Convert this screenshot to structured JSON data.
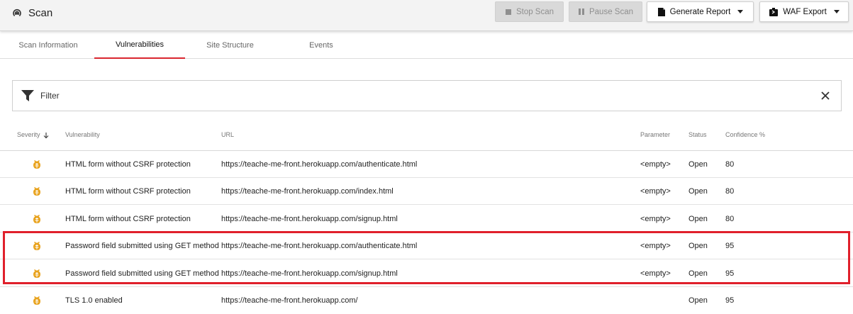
{
  "header": {
    "title": "Scan",
    "buttons": {
      "stop_scan": "Stop Scan",
      "pause_scan": "Pause Scan",
      "generate_report": "Generate Report",
      "waf_export": "WAF Export"
    }
  },
  "tabs": [
    {
      "label": "Scan Information",
      "active": false
    },
    {
      "label": "Vulnerabilities",
      "active": true
    },
    {
      "label": "Site Structure",
      "active": false
    },
    {
      "label": "Events",
      "active": false
    }
  ],
  "filter": {
    "placeholder": "Filter"
  },
  "table": {
    "columns": {
      "severity": "Severity",
      "vulnerability": "Vulnerability",
      "url": "URL",
      "parameter": "Parameter",
      "status": "Status",
      "confidence": "Confidence %"
    },
    "sort_indicator": "descending",
    "rows": [
      {
        "vulnerability": "HTML form without CSRF protection",
        "url": "https://teache-me-front.herokuapp.com/authenticate.html",
        "parameter": "<empty>",
        "status": "Open",
        "confidence": "80"
      },
      {
        "vulnerability": "HTML form without CSRF protection",
        "url": "https://teache-me-front.herokuapp.com/index.html",
        "parameter": "<empty>",
        "status": "Open",
        "confidence": "80"
      },
      {
        "vulnerability": "HTML form without CSRF protection",
        "url": "https://teache-me-front.herokuapp.com/signup.html",
        "parameter": "<empty>",
        "status": "Open",
        "confidence": "80"
      },
      {
        "vulnerability": "Password field submitted using GET method",
        "url": "https://teache-me-front.herokuapp.com/authenticate.html",
        "parameter": "<empty>",
        "status": "Open",
        "confidence": "95"
      },
      {
        "vulnerability": "Password field submitted using GET method",
        "url": "https://teache-me-front.herokuapp.com/signup.html",
        "parameter": "<empty>",
        "status": "Open",
        "confidence": "95"
      },
      {
        "vulnerability": "TLS 1.0 enabled",
        "url": "https://teache-me-front.herokuapp.com/",
        "parameter": "",
        "status": "Open",
        "confidence": "95"
      }
    ]
  },
  "colors": {
    "accent": "#d9262f",
    "severity_icon": "#e8a21c",
    "highlight_box": "#e0202b"
  },
  "icons": {
    "app": "scan-icon",
    "stop": "stop-icon",
    "pause": "pause-icon",
    "report": "document-icon",
    "waf": "export-icon",
    "filter": "filter-icon",
    "clear": "close-icon",
    "severity": "bug-icon",
    "sort": "arrow-down-icon"
  }
}
